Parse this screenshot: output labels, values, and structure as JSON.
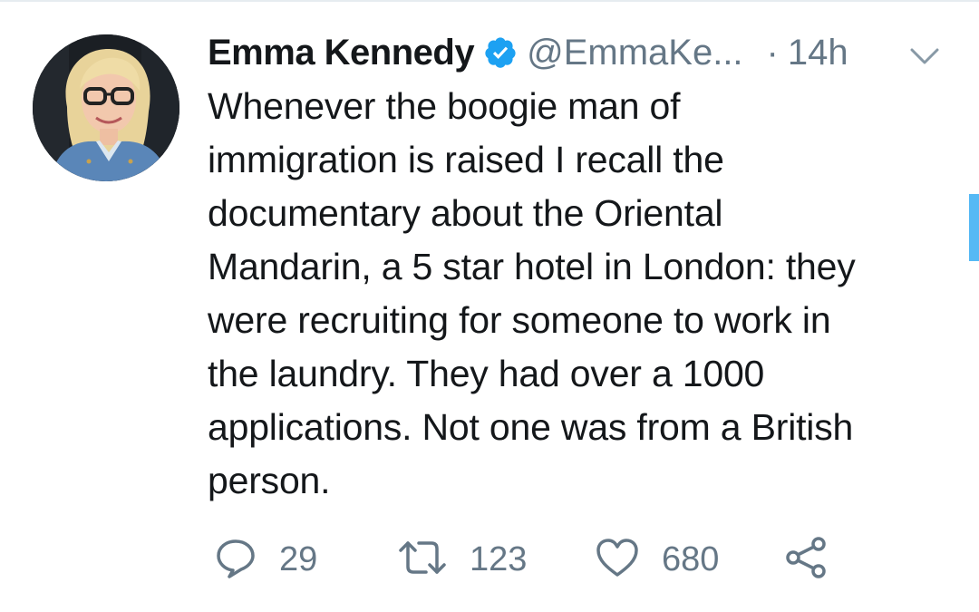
{
  "tweet": {
    "display_name": "Emma Kennedy",
    "handle": "@EmmaKe...",
    "separator": "·",
    "time": "14h",
    "text": "Whenever the boogie man of\nimmigration is raised I recall the\ndocumentary about the Oriental\nMandarin, a 5 star hotel in London: they\nwere recruiting for someone to work in\nthe laundry. They had over a 1000\napplications. Not one was from a British\nperson.",
    "verified": true
  },
  "actions": {
    "reply_count": "29",
    "retweet_count": "123",
    "like_count": "680"
  },
  "icons": {
    "verified": "verified-badge-icon",
    "more": "chevron-down-icon",
    "reply": "reply-bubble-icon",
    "retweet": "retweet-icon",
    "like": "heart-icon",
    "share": "share-icon"
  },
  "colors": {
    "text": "#14171a",
    "secondary": "#657786",
    "accent": "#1da1f2"
  }
}
